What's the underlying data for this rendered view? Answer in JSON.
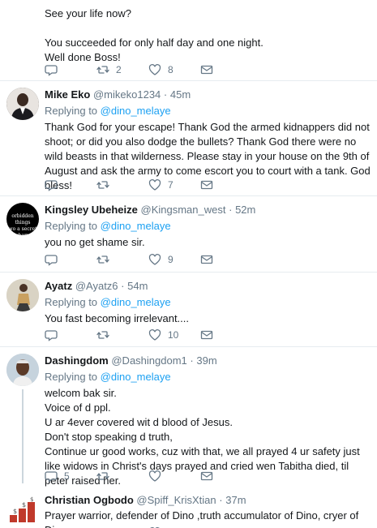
{
  "tweets": [
    {
      "body": "See your life now?\n\nYou succeeded for only half day and one night.\nWell done Boss!",
      "stats": {
        "replies": "",
        "retweets": "2",
        "likes": "8"
      }
    },
    {
      "name": "Mike Eko",
      "handle": "@mikeko1234",
      "time": "45m",
      "replying_label": "Replying to",
      "mention": "@dino_melaye",
      "body": "Thank God for your escape! Thank God the armed kidnappers did not shoot; or did you also dodge the bullets? Thank God there were no wild beasts in that wilderness. Please stay in your house on the 9th of August and ask the army to come escort you to court with a tank. God bless!",
      "stats": {
        "replies": "",
        "retweets": "",
        "likes": "7"
      }
    },
    {
      "name": "Kingsley Ubeheize",
      "handle": "@Kingsman_west",
      "time": "52m",
      "replying_label": "Replying to",
      "mention": "@dino_melaye",
      "body": "you no get shame sir.",
      "avatar_text": "orbidden things\nwo a secret charn",
      "stats": {
        "replies": "",
        "retweets": "",
        "likes": "9"
      }
    },
    {
      "name": "Ayatz",
      "handle": "@Ayatz6",
      "time": "54m",
      "replying_label": "Replying to",
      "mention": "@dino_melaye",
      "body": "You fast becoming  irrelevant....",
      "stats": {
        "replies": "",
        "retweets": "",
        "likes": "10"
      }
    },
    {
      "name": "Dashingdom",
      "handle": "@Dashingdom1",
      "time": "39m",
      "replying_label": "Replying to",
      "mention": "@dino_melaye",
      "body": "welcom bak sir.\nVoice of d ppl.\nU ar 4ever covered wit d blood of Jesus.\nDon't stop speaking d truth,\nContinue ur good works, cuz with that, we all prayed 4 ur safety just like widows in Christ's days prayed and cried wen Tabitha died, til peter raised her.",
      "stats": {
        "replies": "5",
        "retweets": "",
        "likes": ""
      }
    },
    {
      "name": "Christian Ogbodo",
      "handle": "@Spiff_KrisXtian",
      "time": "37m",
      "body": "Prayer warrior, defender of Dino ,truth accumulator of Dino, cryer of Dino"
    }
  ],
  "separator": "·",
  "colors": {
    "accent": "#1da1f2",
    "muted": "#657786",
    "text": "#14171a",
    "divider": "#e6ecf0"
  }
}
